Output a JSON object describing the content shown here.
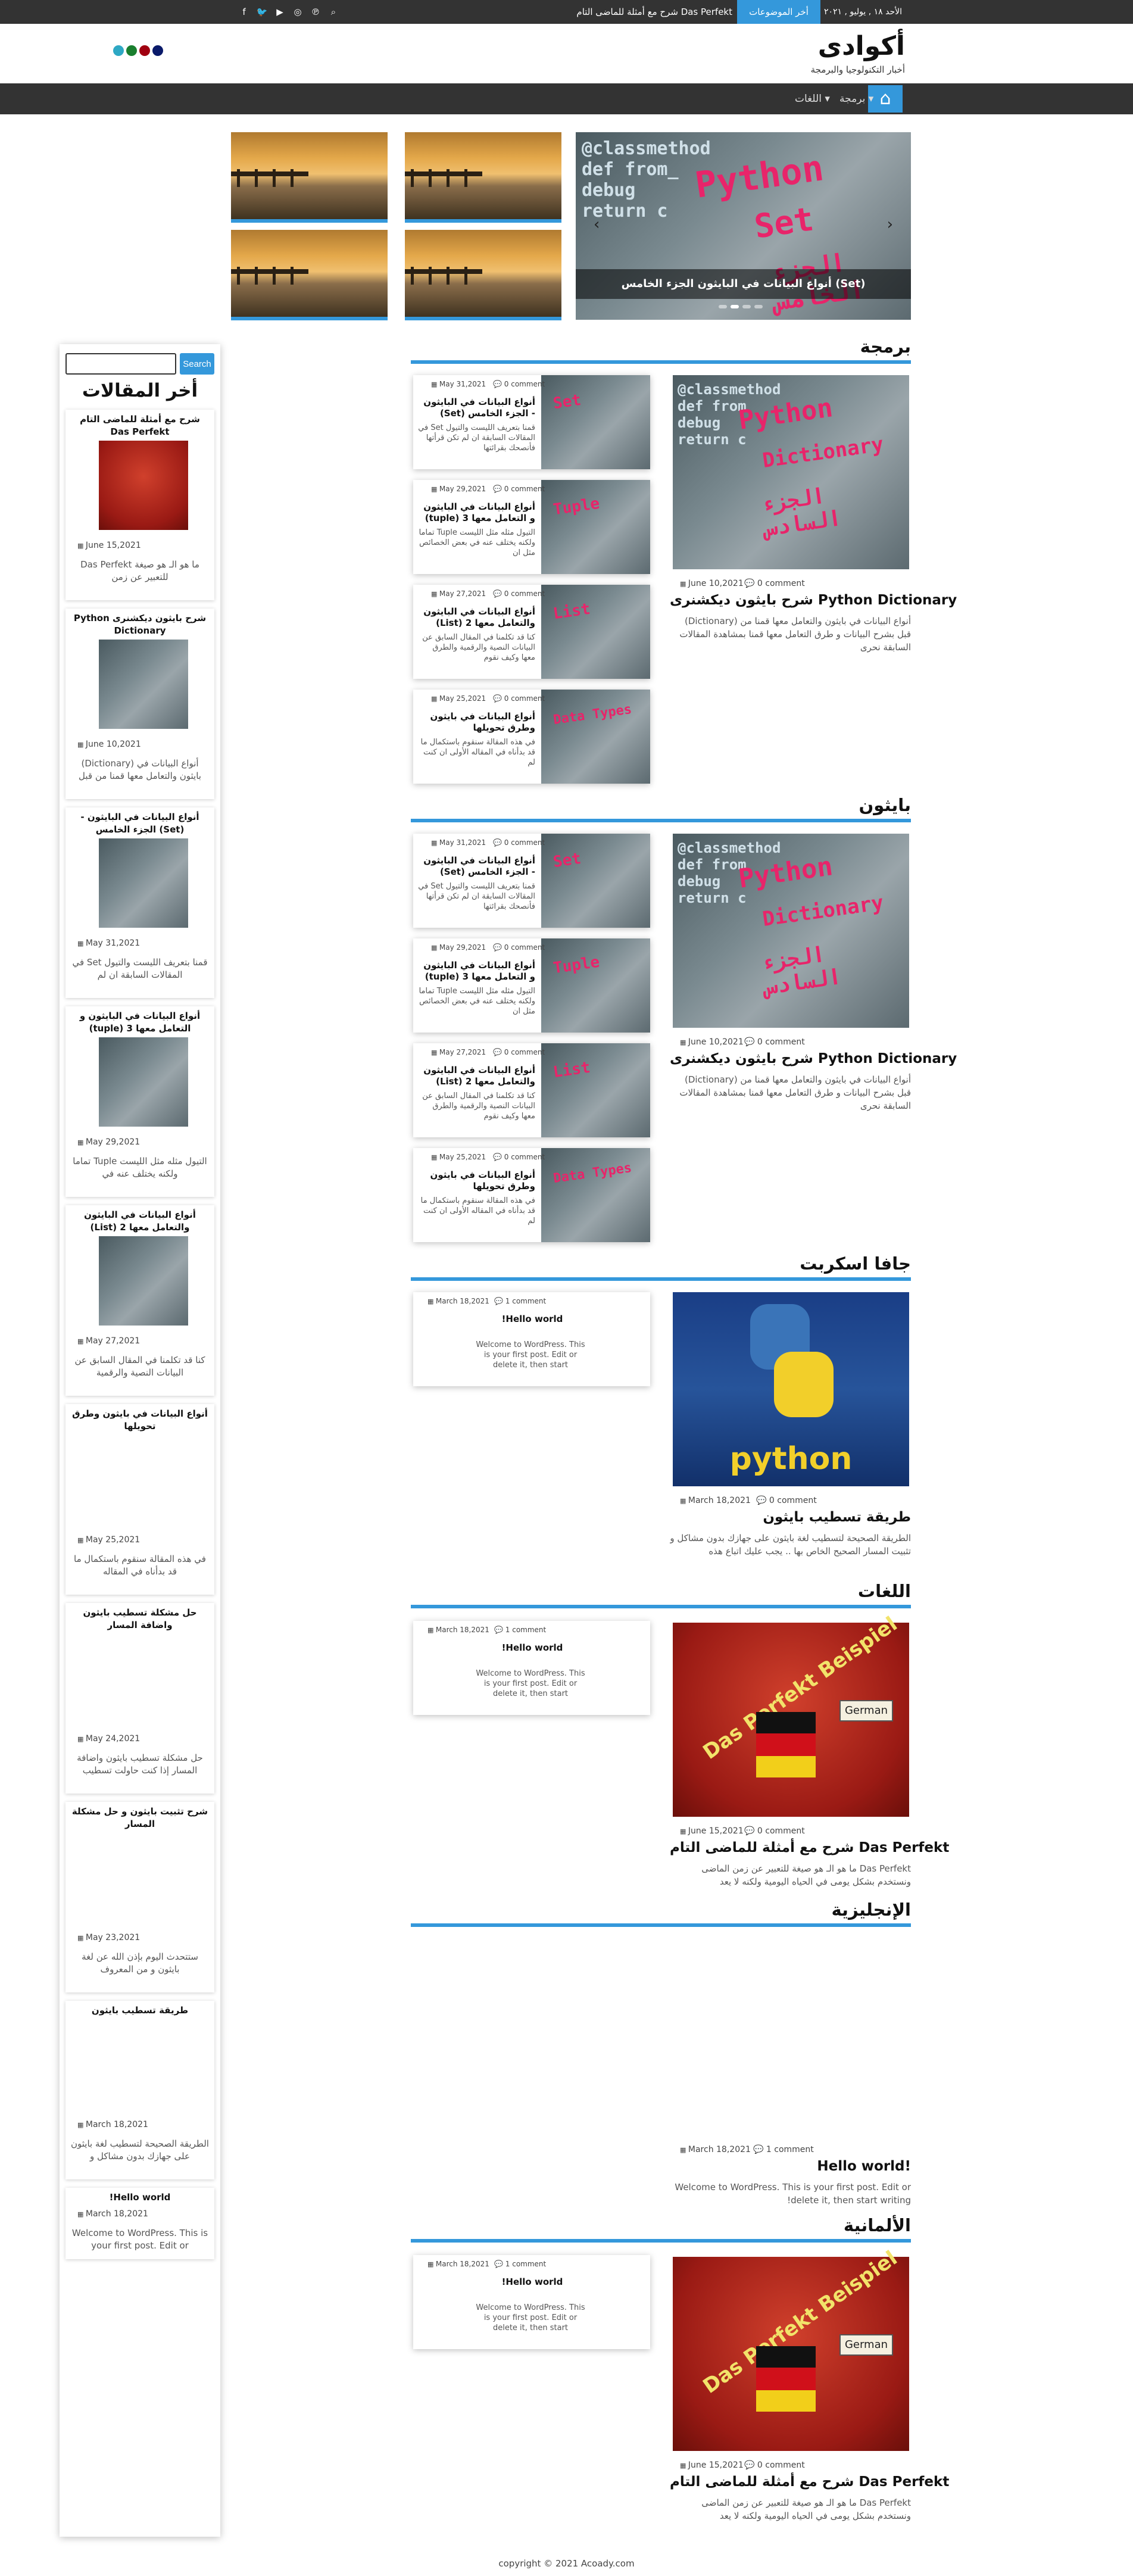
{
  "topbar": {
    "date": "الأحد ١٨ , يوليو , ٢٠٢١",
    "topics_label": "أخر الموضوعات",
    "ticker": "شرح مع أمثلة للماضى التام Das Perfekt",
    "social_icons": [
      "search-icon",
      "youtube-icon",
      "instagram-icon",
      "pinterest-icon",
      "twitter-icon",
      "facebook-icon"
    ]
  },
  "header": {
    "site_title": "أكوادى",
    "site_description": "أخبار التكنولوجيا والبرمجة",
    "dot_colors": [
      "#2ea8c4",
      "#1a7f2e",
      "#a00010",
      "#0a1a6a"
    ]
  },
  "nav": {
    "home_icon": "home-icon",
    "items": [
      "برمجة",
      "اللغات"
    ]
  },
  "slider": {
    "caption": "أنواع البيانات في البايثون الجزء الخامس (Set)",
    "code_word": "Python",
    "code_word2": "Set",
    "arabic_word": "الجزء الخامس"
  },
  "sections": [
    {
      "title": "برمجة",
      "featured": {
        "title": "شرح بايثون ديكشنرى Python Dictionary",
        "date": "June 10,2021",
        "comments": "0 comment",
        "excerpt": "أنواع البيانات في بايثون والتعامل معها قمنا من (Dictionary) قبل بشرح البيانات و طرق التعامل معها قمنا بمشاهدة المقالات السابقة نحرى",
        "img_word": "Python",
        "img_word2": "Dictionary",
        "img_ar": "الجزء السادس"
      },
      "cards": [
        {
          "title": "أنواع البيانات في البايثون - الجزء الخامس (Set)",
          "date": "May 31,2021",
          "comments": "0 comment",
          "excerpt": "قمنا بتعريف الليست والتيول Set في المقالات السابقة ان لم تكن قرأتها فأنصحك بقرائتها",
          "img_word": "Set"
        },
        {
          "title": "أنواع البيانات في البايثون و التعامل معها 3 (tuple)",
          "date": "May 29,2021",
          "comments": "0 comment",
          "excerpt": "التيول مثله مثل الليست Tuple تماما ولكنه يختلف عنه في بعض الخصائص مثل ان",
          "img_word": "Tuple"
        },
        {
          "title": "أنواع البيانات في البايثون والتعامل معها 2 (List)",
          "date": "May 27,2021",
          "comments": "0 comment",
          "excerpt": "كنا قد تكلمنا في المقال السابق عن البيانات النصية والرقمية والطرق معها وكيف نقوم",
          "img_word": "List"
        },
        {
          "title": "أنواع البيانات في بايثون وطرق تحويلها",
          "date": "May 25,2021",
          "comments": "0 comment",
          "excerpt": "في هذه المقالة سنقوم باستكمال ما قد بدأناه في المقاله الأولى ان كنت لم",
          "img_word": "Data Types"
        }
      ]
    },
    {
      "title": "بايثون",
      "featured": {
        "title": "شرح بايثون ديكشنرى Python Dictionary",
        "date": "June 10,2021",
        "comments": "0 comment",
        "excerpt": "أنواع البيانات في بايثون والتعامل معها قمنا من (Dictionary) قبل بشرح البيانات و طرق التعامل معها قمنا بمشاهدة المقالات السابقة نحرى",
        "img_word": "Python",
        "img_word2": "Dictionary",
        "img_ar": "الجزء السادس"
      },
      "cards": [
        {
          "title": "أنواع البيانات في البايثون - الجزء الخامس (Set)",
          "date": "May 31,2021",
          "comments": "0 comment",
          "excerpt": "قمنا بتعريف الليست والتيول Set في المقالات السابقة ان لم تكن قرأتها فأنصحك بقرائتها",
          "img_word": "Set"
        },
        {
          "title": "أنواع البيانات في البايثون و التعامل معها 3 (tuple)",
          "date": "May 29,2021",
          "comments": "0 comment",
          "excerpt": "التيول مثله مثل الليست Tuple تماما ولكنه يختلف عنه في بعض الخصائص مثل ان",
          "img_word": "Tuple"
        },
        {
          "title": "أنواع البيانات في البايثون والتعامل معها 2 (List)",
          "date": "May 27,2021",
          "comments": "0 comment",
          "excerpt": "كنا قد تكلمنا في المقال السابق عن البيانات النصية والرقمية والطرق معها وكيف نقوم",
          "img_word": "List"
        },
        {
          "title": "أنواع البيانات في بايثون وطرق تحويلها",
          "date": "May 25,2021",
          "comments": "0 comment",
          "excerpt": "في هذه المقالة سنقوم باستكمال ما قد بدأناه في المقاله الأولى ان كنت لم",
          "img_word": "Data Types"
        }
      ]
    },
    {
      "title": "جافا اسكربت",
      "featured": {
        "title": "طريقة تسطيب بايثون",
        "date": "March 18,2021",
        "comments": "0 comment",
        "excerpt": "الطريقة الصحيحة لتسطيب لغة بايثون على جهازك بدون مشاكل و تثبيت المسار الصحيح الخاص بها .. يجب عليك اتباع هذه",
        "img_word": "python"
      },
      "card": {
        "title": "Hello world!",
        "date": "March 18,2021",
        "comments": "1 comment",
        "excerpt": "Welcome to WordPress. This is your first post. Edit or delete it, then start"
      }
    },
    {
      "title": "اللغات",
      "featured": {
        "title": "شرح مع أمثلة للماضى التام Das Perfekt",
        "date": "June 15,2021",
        "comments": "0 comment",
        "excerpt": "Das Perfekt ما هو الـ هو صيغة للتعبير عن زمن الماضى ونستخدم بشكل يومى في الحياه اليومية ولكنه لا يعد",
        "img_word": "Das Perfekt Beispiel",
        "img_word2": "German"
      },
      "card": {
        "title": "Hello world!",
        "date": "March 18,2021",
        "comments": "1 comment",
        "excerpt": "Welcome to WordPress. This is your first post. Edit or delete it, then start"
      }
    },
    {
      "title": "الإنجليزية",
      "featured": {
        "title": "Hello world!",
        "date": "March 18,2021",
        "comments": "1 comment",
        "excerpt": "Welcome to WordPress. This is your first post. Edit or delete it, then start writing!"
      }
    },
    {
      "title": "الألمانية",
      "featured": {
        "title": "شرح مع أمثلة للماضى التام Das Perfekt",
        "date": "June 15,2021",
        "comments": "0 comment",
        "excerpt": "Das Perfekt ما هو الـ هو صيغة للتعبير عن زمن الماضى ونستخدم بشكل يومى في الحياه اليومية ولكنه لا يعد",
        "img_word": "Das Perfekt Beispiel",
        "img_word2": "German"
      },
      "card": {
        "title": "Hello world!",
        "date": "March 18,2021",
        "comments": "1 comment",
        "excerpt": "Welcome to WordPress. This is your first post. Edit or delete it, then start"
      }
    }
  ],
  "sidebar": {
    "search_button": "Search",
    "heading": "أخر المقالات",
    "items": [
      {
        "title": "شرح مع أمثلة للماضى التام Das Perfekt",
        "date": "June 15,2021",
        "excerpt": "ما هو الـ هو صيغة Das Perfekt للتعبير عن زمن"
      },
      {
        "title": "شرح بايثون ديكشنرى Python Dictionary",
        "date": "June 10,2021",
        "excerpt": "أنواع البيانات في (Dictionary) بايثون والتعامل معها قمنا من قبل"
      },
      {
        "title": "أنواع البيانات في البايثون - (Set) الجزء الخامس",
        "date": "May 31,2021",
        "excerpt": "قمنا بتعريف الليست والتيول Set في المقالات السابقة ان لم"
      },
      {
        "title": "أنواع البيانات في البايثون و التعامل معها 3 (tuple)",
        "date": "May 29,2021",
        "excerpt": "التيول مثله مثل الليست Tuple تماما ولكنه يختلف عنه في"
      },
      {
        "title": "أنواع البيانات في البايثون والتعامل معها 2 (List)",
        "date": "May 27,2021",
        "excerpt": "كنا قد تكلمنا في المقال السابق عن البيانات النصية والرقمية"
      },
      {
        "title": "أنواع البيانات في بايثون وطرق تحويلها",
        "date": "May 25,2021",
        "excerpt": "في هذه المقالة سنقوم باستكمال ما قد بدأناه في المقاله"
      },
      {
        "title": "حل مشكلة تسطيب بايثون واضافة المسار",
        "date": "May 24,2021",
        "excerpt": "حل مشكلة تسطيب بايثون واضافة المسار إذا كنت حاولت تسطيب"
      },
      {
        "title": "شرح تثبيت بايثون و حل مشكلة المسار",
        "date": "May 23,2021",
        "excerpt": "ستتحدث اليوم بإذن الله عن لغة بايثون و من المعروف"
      },
      {
        "title": "طريقة تسطيب بايثون",
        "date": "March 18,2021",
        "excerpt": "الطريقة الصحيحة لتسطيب لغة بايثون على جهازك بدون مشاكل و"
      },
      {
        "title": "Hello world!",
        "date": "March 18,2021",
        "excerpt": "Welcome to WordPress. This is your first post. Edit or"
      }
    ]
  },
  "footer": {
    "copyright": "copyright © 2021 Acoady.com"
  }
}
